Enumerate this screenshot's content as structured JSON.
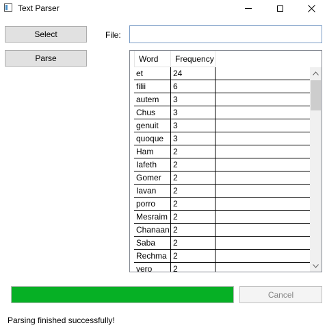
{
  "window": {
    "title": "Text Parser"
  },
  "buttons": {
    "select_label": "Select",
    "parse_label": "Parse",
    "cancel_label": "Cancel"
  },
  "file": {
    "label": "File:",
    "value": ""
  },
  "grid": {
    "columns": [
      "Word",
      "Frequency"
    ],
    "rows": [
      {
        "word": "et",
        "frequency": "24"
      },
      {
        "word": "filii",
        "frequency": "6"
      },
      {
        "word": "autem",
        "frequency": "3"
      },
      {
        "word": "Chus",
        "frequency": "3"
      },
      {
        "word": "genuit",
        "frequency": "3"
      },
      {
        "word": "quoque",
        "frequency": "3"
      },
      {
        "word": "Ham",
        "frequency": "2"
      },
      {
        "word": "Iafeth",
        "frequency": "2"
      },
      {
        "word": "Gomer",
        "frequency": "2"
      },
      {
        "word": "Iavan",
        "frequency": "2"
      },
      {
        "word": "porro",
        "frequency": "2"
      },
      {
        "word": "Mesraim",
        "frequency": "2"
      },
      {
        "word": "Chanaan",
        "frequency": "2"
      },
      {
        "word": "Saba",
        "frequency": "2"
      },
      {
        "word": "Rechma",
        "frequency": "2"
      },
      {
        "word": "vero",
        "frequency": "2"
      }
    ]
  },
  "progress": {
    "fraction": 1.0,
    "color": "#06b025"
  },
  "status": {
    "text": "Parsing finished successfully!"
  },
  "icons": {
    "app": "app-icon",
    "minimize": "minimize-icon",
    "maximize": "maximize-icon",
    "close": "close-icon",
    "scroll_up": "chevron-up-icon",
    "scroll_down": "chevron-down-icon"
  }
}
